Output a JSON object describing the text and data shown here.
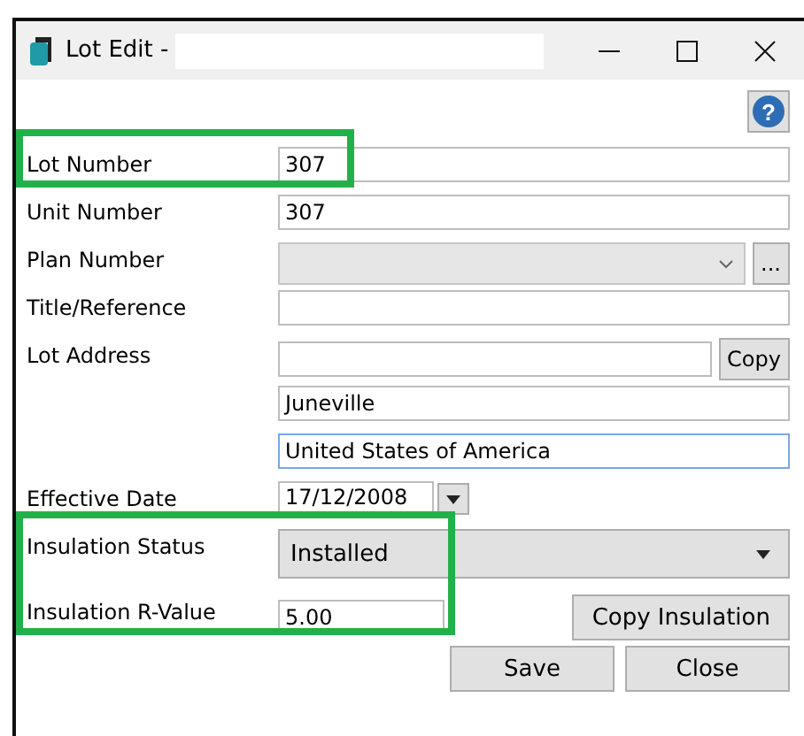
{
  "window": {
    "title": "Lot Edit -"
  },
  "help_button": {
    "label": "?"
  },
  "rows": [
    {
      "kind": "text",
      "label": "Lot Number",
      "value": "307",
      "highlighted": true,
      "focused": false
    },
    {
      "kind": "text",
      "label": "Unit Number",
      "value": "307",
      "highlighted": false,
      "focused": false
    },
    {
      "kind": "combo",
      "label": "Plan Number",
      "button": "...",
      "highlighted": false
    },
    {
      "kind": "text",
      "label": "Title/Reference",
      "highlighted": false,
      "focused": false
    },
    {
      "kind": "text_button",
      "label": "Lot Address",
      "button": "Copy",
      "highlighted": false,
      "focused": false
    },
    {
      "kind": "text",
      "value": "Juneville",
      "highlighted": false,
      "focused": false
    },
    {
      "kind": "text",
      "value": "United States of America",
      "highlighted": false,
      "focused": true
    },
    {
      "kind": "date",
      "label": "Effective Date",
      "value": "17/12/2008",
      "highlighted": false
    },
    {
      "kind": "dropdown",
      "label": "Insulation Status",
      "value": "Installed",
      "highlighted": true
    },
    {
      "kind": "short_button",
      "label": "Insulation R-Value",
      "value": "5.00",
      "button": "Copy Insulation",
      "highlighted": true,
      "focused": false
    }
  ],
  "buttons": [
    "Save",
    "Close"
  ]
}
